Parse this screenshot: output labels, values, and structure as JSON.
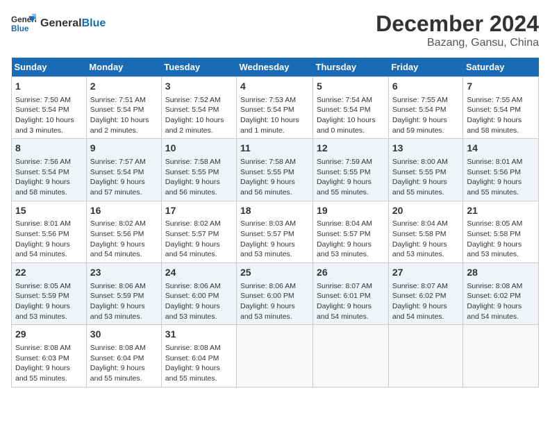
{
  "logo": {
    "line1": "General",
    "line2": "Blue"
  },
  "header": {
    "month": "December 2024",
    "location": "Bazang, Gansu, China"
  },
  "days_of_week": [
    "Sunday",
    "Monday",
    "Tuesday",
    "Wednesday",
    "Thursday",
    "Friday",
    "Saturday"
  ],
  "weeks": [
    [
      {
        "day": "1",
        "info": "Sunrise: 7:50 AM\nSunset: 5:54 PM\nDaylight: 10 hours\nand 3 minutes."
      },
      {
        "day": "2",
        "info": "Sunrise: 7:51 AM\nSunset: 5:54 PM\nDaylight: 10 hours\nand 2 minutes."
      },
      {
        "day": "3",
        "info": "Sunrise: 7:52 AM\nSunset: 5:54 PM\nDaylight: 10 hours\nand 2 minutes."
      },
      {
        "day": "4",
        "info": "Sunrise: 7:53 AM\nSunset: 5:54 PM\nDaylight: 10 hours\nand 1 minute."
      },
      {
        "day": "5",
        "info": "Sunrise: 7:54 AM\nSunset: 5:54 PM\nDaylight: 10 hours\nand 0 minutes."
      },
      {
        "day": "6",
        "info": "Sunrise: 7:55 AM\nSunset: 5:54 PM\nDaylight: 9 hours\nand 59 minutes."
      },
      {
        "day": "7",
        "info": "Sunrise: 7:55 AM\nSunset: 5:54 PM\nDaylight: 9 hours\nand 58 minutes."
      }
    ],
    [
      {
        "day": "8",
        "info": "Sunrise: 7:56 AM\nSunset: 5:54 PM\nDaylight: 9 hours\nand 58 minutes."
      },
      {
        "day": "9",
        "info": "Sunrise: 7:57 AM\nSunset: 5:54 PM\nDaylight: 9 hours\nand 57 minutes."
      },
      {
        "day": "10",
        "info": "Sunrise: 7:58 AM\nSunset: 5:55 PM\nDaylight: 9 hours\nand 56 minutes."
      },
      {
        "day": "11",
        "info": "Sunrise: 7:58 AM\nSunset: 5:55 PM\nDaylight: 9 hours\nand 56 minutes."
      },
      {
        "day": "12",
        "info": "Sunrise: 7:59 AM\nSunset: 5:55 PM\nDaylight: 9 hours\nand 55 minutes."
      },
      {
        "day": "13",
        "info": "Sunrise: 8:00 AM\nSunset: 5:55 PM\nDaylight: 9 hours\nand 55 minutes."
      },
      {
        "day": "14",
        "info": "Sunrise: 8:01 AM\nSunset: 5:56 PM\nDaylight: 9 hours\nand 55 minutes."
      }
    ],
    [
      {
        "day": "15",
        "info": "Sunrise: 8:01 AM\nSunset: 5:56 PM\nDaylight: 9 hours\nand 54 minutes."
      },
      {
        "day": "16",
        "info": "Sunrise: 8:02 AM\nSunset: 5:56 PM\nDaylight: 9 hours\nand 54 minutes."
      },
      {
        "day": "17",
        "info": "Sunrise: 8:02 AM\nSunset: 5:57 PM\nDaylight: 9 hours\nand 54 minutes."
      },
      {
        "day": "18",
        "info": "Sunrise: 8:03 AM\nSunset: 5:57 PM\nDaylight: 9 hours\nand 53 minutes."
      },
      {
        "day": "19",
        "info": "Sunrise: 8:04 AM\nSunset: 5:57 PM\nDaylight: 9 hours\nand 53 minutes."
      },
      {
        "day": "20",
        "info": "Sunrise: 8:04 AM\nSunset: 5:58 PM\nDaylight: 9 hours\nand 53 minutes."
      },
      {
        "day": "21",
        "info": "Sunrise: 8:05 AM\nSunset: 5:58 PM\nDaylight: 9 hours\nand 53 minutes."
      }
    ],
    [
      {
        "day": "22",
        "info": "Sunrise: 8:05 AM\nSunset: 5:59 PM\nDaylight: 9 hours\nand 53 minutes."
      },
      {
        "day": "23",
        "info": "Sunrise: 8:06 AM\nSunset: 5:59 PM\nDaylight: 9 hours\nand 53 minutes."
      },
      {
        "day": "24",
        "info": "Sunrise: 8:06 AM\nSunset: 6:00 PM\nDaylight: 9 hours\nand 53 minutes."
      },
      {
        "day": "25",
        "info": "Sunrise: 8:06 AM\nSunset: 6:00 PM\nDaylight: 9 hours\nand 53 minutes."
      },
      {
        "day": "26",
        "info": "Sunrise: 8:07 AM\nSunset: 6:01 PM\nDaylight: 9 hours\nand 54 minutes."
      },
      {
        "day": "27",
        "info": "Sunrise: 8:07 AM\nSunset: 6:02 PM\nDaylight: 9 hours\nand 54 minutes."
      },
      {
        "day": "28",
        "info": "Sunrise: 8:08 AM\nSunset: 6:02 PM\nDaylight: 9 hours\nand 54 minutes."
      }
    ],
    [
      {
        "day": "29",
        "info": "Sunrise: 8:08 AM\nSunset: 6:03 PM\nDaylight: 9 hours\nand 55 minutes."
      },
      {
        "day": "30",
        "info": "Sunrise: 8:08 AM\nSunset: 6:04 PM\nDaylight: 9 hours\nand 55 minutes."
      },
      {
        "day": "31",
        "info": "Sunrise: 8:08 AM\nSunset: 6:04 PM\nDaylight: 9 hours\nand 55 minutes."
      },
      {
        "day": "",
        "info": ""
      },
      {
        "day": "",
        "info": ""
      },
      {
        "day": "",
        "info": ""
      },
      {
        "day": "",
        "info": ""
      }
    ]
  ]
}
